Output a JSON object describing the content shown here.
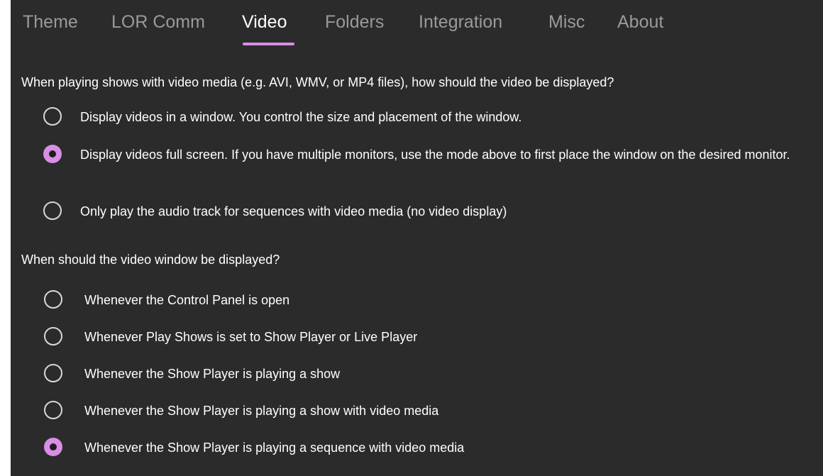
{
  "accent_color": "#d98ee6",
  "tabs": [
    {
      "label": "Theme",
      "selected": false
    },
    {
      "label": "LOR Comm",
      "selected": false
    },
    {
      "label": "Video",
      "selected": true
    },
    {
      "label": "Folders",
      "selected": false
    },
    {
      "label": "Integration",
      "selected": false
    },
    {
      "label": "Misc",
      "selected": false
    },
    {
      "label": "About",
      "selected": false
    }
  ],
  "display_mode": {
    "question": "When playing shows with video media (e.g. AVI, WMV, or MP4 files), how should the video be displayed?",
    "options": [
      {
        "label": "Display videos in a window. You control the size and placement of the window.",
        "checked": false
      },
      {
        "label": "Display videos full screen. If you have multiple monitors, use the mode above to first place the window on the desired monitor.",
        "checked": true
      },
      {
        "label": "Only play the audio track for sequences with video media (no video display)",
        "checked": false
      }
    ]
  },
  "window_timing": {
    "question": "When should the video window be displayed?",
    "options": [
      {
        "label": "Whenever the Control Panel is open",
        "checked": false
      },
      {
        "label": "Whenever Play Shows is set to Show Player or Live Player",
        "checked": false
      },
      {
        "label": "Whenever the Show Player is playing a show",
        "checked": false
      },
      {
        "label": "Whenever the Show Player is playing a show with video media",
        "checked": false
      },
      {
        "label": "Whenever the Show Player is playing a sequence with video media",
        "checked": true
      }
    ]
  }
}
